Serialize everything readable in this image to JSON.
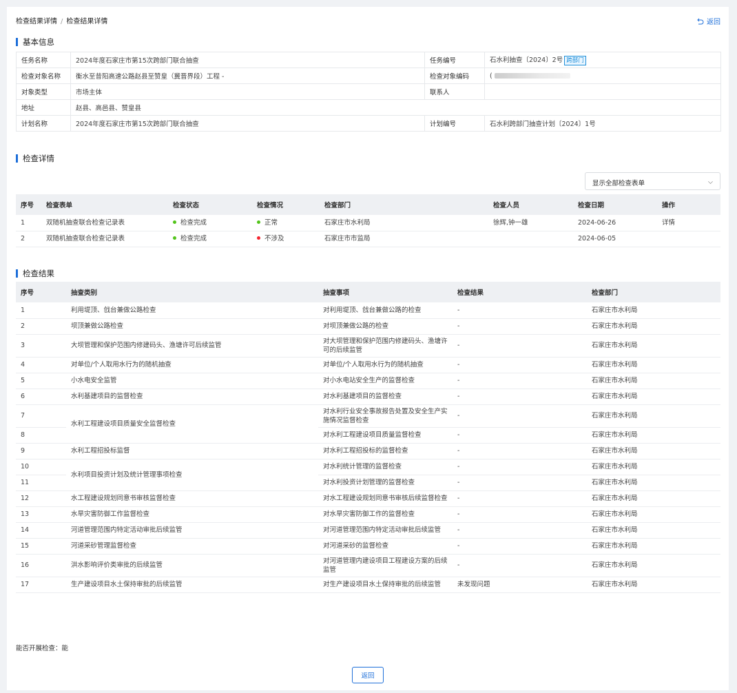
{
  "breadcrumb": {
    "level1": "检查结果详情",
    "separator": "/",
    "level2": "检查结果详情"
  },
  "back_link": "返回",
  "basic_info": {
    "title": "基本信息",
    "task_name_label": "任务名称",
    "task_name": "2024年度石家庄市第15次跨部门联合抽查",
    "task_no_label": "任务编号",
    "task_no": "石水利抽查〔2024〕2号",
    "task_tag": "跨部门",
    "object_name_label": "检查对象名称",
    "object_name": "衡水至昔阳高速公路赵县至赞皇（冀晋界段）工程 -",
    "object_code_label": "检查对象编码",
    "object_code": "(",
    "object_type_label": "对象类型",
    "object_type": "市场主体",
    "contact_label": "联系人",
    "contact": "",
    "address_label": "地址",
    "address": "赵县、高邑县、赞皇县",
    "plan_name_label": "计划名称",
    "plan_name": "2024年度石家庄市第15次跨部门联合抽查",
    "plan_no_label": "计划编号",
    "plan_no": "石水利跨部门抽查计划〔2024〕1号"
  },
  "detail": {
    "title": "检查详情",
    "filter_select": "显示全部检查表单",
    "headers": [
      "序号",
      "检查表单",
      "检查状态",
      "检查情况",
      "检查部门",
      "检查人员",
      "检查日期",
      "操作"
    ],
    "rows": [
      {
        "no": "1",
        "form": "双随机抽查联合检查记录表",
        "status": "检查完成",
        "condition": "正常",
        "dept": "石家庄市水利局",
        "staff": "徐辉,钟一雄",
        "date": "2024-06-26",
        "action": "详情"
      },
      {
        "no": "2",
        "form": "双随机抽查联合检查记录表",
        "status": "检查完成",
        "condition": "不涉及",
        "dept": "石家庄市市监局",
        "staff": "",
        "date": "2024-06-05",
        "action": ""
      }
    ],
    "colors": {
      "ok": "#52c41a",
      "bad": "#f5222d"
    }
  },
  "results": {
    "title": "检查结果",
    "headers": [
      "序号",
      "抽查类别",
      "抽查事项",
      "检查结果",
      "检查部门"
    ],
    "rows": [
      {
        "no": "1",
        "category": "利用堤顶、戗台兼做公路检查",
        "item": "对利用堤顶、戗台兼做公路的检查",
        "result": "-",
        "dept": "石家庄市水利局"
      },
      {
        "no": "2",
        "category": "坝顶兼做公路检查",
        "item": "对坝顶兼做公路的检查",
        "result": "-",
        "dept": "石家庄市水利局"
      },
      {
        "no": "3",
        "category": "大坝管理和保护范围内修建码头、渔塘许可后续监管",
        "item": "对大坝管理和保护范围内修建码头、渔塘许可的后续监管",
        "result": "-",
        "dept": "石家庄市水利局"
      },
      {
        "no": "4",
        "category": "对单位/个人取用水行为的随机抽查",
        "item": "对单位/个人取用水行为的随机抽查",
        "result": "-",
        "dept": "石家庄市水利局"
      },
      {
        "no": "5",
        "category": "小水电安全监管",
        "item": "对小水电站安全生产的监督检查",
        "result": "-",
        "dept": "石家庄市水利局"
      },
      {
        "no": "6",
        "category": "水利基建项目的监督检查",
        "item": "对水利基建项目的监督检查",
        "result": "-",
        "dept": "石家庄市水利局"
      },
      {
        "no": "7",
        "category": "水利工程建设项目质量安全监督检查",
        "item": "对水利行业安全事故报告处置及安全生产实施情况监督检查",
        "result": "-",
        "dept": "石家庄市水利局"
      },
      {
        "no": "8",
        "category": "",
        "item": "对水利工程建设项目质量监督检查",
        "result": "-",
        "dept": "石家庄市水利局"
      },
      {
        "no": "9",
        "category": "水利工程招投标监督",
        "item": "对水利工程招投标的监督检查",
        "result": "-",
        "dept": "石家庄市水利局"
      },
      {
        "no": "10",
        "category": "水利项目投资计划及统计管理事项检查",
        "item": "对水利统计管理的监督检查",
        "result": "-",
        "dept": "石家庄市水利局"
      },
      {
        "no": "11",
        "category": "",
        "item": "对水利投资计划管理的监督检查",
        "result": "-",
        "dept": "石家庄市水利局"
      },
      {
        "no": "12",
        "category": "水工程建设规划同意书审核监督检查",
        "item": "对水工程建设规划同意书审核后续监督检查",
        "result": "-",
        "dept": "石家庄市水利局"
      },
      {
        "no": "13",
        "category": "水旱灾害防御工作监督检查",
        "item": "对水旱灾害防御工作的监督检查",
        "result": "-",
        "dept": "石家庄市水利局"
      },
      {
        "no": "14",
        "category": "河道管理范围内特定活动审批后续监管",
        "item": "对河道管理范围内特定活动审批后续监管",
        "result": "-",
        "dept": "石家庄市水利局"
      },
      {
        "no": "15",
        "category": "河道采砂管理监督检查",
        "item": "对河道采砂的监督检查",
        "result": "-",
        "dept": "石家庄市水利局"
      },
      {
        "no": "16",
        "category": "洪水影响评价类审批的后续监管",
        "item": "对河道管理内建设项目工程建设方案的后续监管",
        "result": "-",
        "dept": "石家庄市水利局"
      },
      {
        "no": "17",
        "category": "生产建设项目水土保持审批的后续监管",
        "item": "对生产建设项目水土保持审批的后续监管",
        "result": "未发现问题",
        "dept": "石家庄市水利局"
      }
    ]
  },
  "can_check": "能否开展检查：能",
  "bottom_back": "返回",
  "accent_color": "#1e6fd9"
}
